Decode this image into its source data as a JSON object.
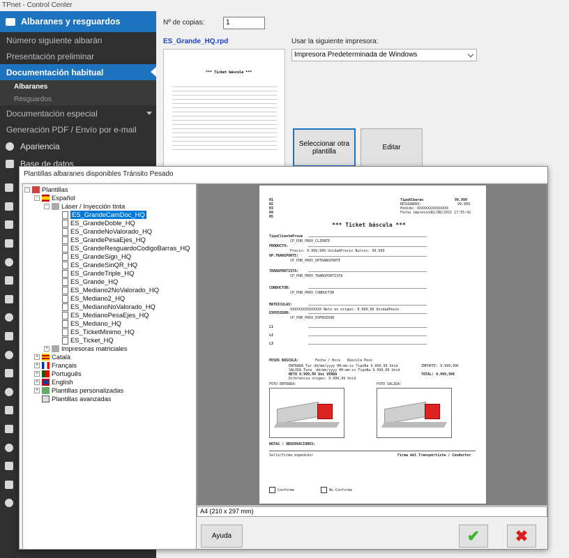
{
  "window": {
    "title": "TPnet - Control Center"
  },
  "sidebar": {
    "header": "Albaranes y resguardos",
    "items": [
      {
        "label": "Número siguiente albarán"
      },
      {
        "label": "Presentación preliminar"
      },
      {
        "label": "Documentación habitual"
      },
      {
        "label": "Documentación especial"
      },
      {
        "label": "Generación PDF / Envío por e-mail"
      }
    ],
    "subitems": [
      {
        "label": "Albaranes"
      },
      {
        "label": "Resguardos"
      }
    ],
    "icon_items": [
      {
        "label": "Apariencia"
      },
      {
        "label": "Base de datos"
      }
    ]
  },
  "main": {
    "copies_label": "Nº de copias:",
    "copies_value": "1",
    "file_name": "ES_Grande_HQ.rpd",
    "printer_label": "Usar la siguiente impresora:",
    "printer_value": "Impresora Predeterminada de Windows",
    "select_template_button": "Seleccionar otra plantilla",
    "edit_button": "Editar"
  },
  "dialog": {
    "title": "Plantillas albaranes disponibles Tránsito Pesado",
    "tree": {
      "root": "Plantillas",
      "language_es": "Español",
      "laser_folder": "Láser / Inyección tinta",
      "templates": [
        "ES_GrandeCamDoc_HQ",
        "ES_GrandeDoble_HQ",
        "ES_GrandeNoValorado_HQ",
        "ES_GrandePesaEjes_HQ",
        "ES_GrandeResguardoCodigoBarras_HQ",
        "ES_GrandeSign_HQ",
        "ES_GrandeSinQR_HQ",
        "ES_GrandeTriple_HQ",
        "ES_Grande_HQ",
        "ES_Mediano2NoValorado_HQ",
        "ES_Mediano2_HQ",
        "ES_MedianoNoValorado_HQ",
        "ES_MedianoPesaEjes_HQ",
        "ES_Mediano_HQ",
        "ES_TicketMinimo_HQ",
        "ES_Ticket_HQ"
      ],
      "matrix_folder": "Impresoras matriciales",
      "other_languages": [
        "Català",
        "Français",
        "Português",
        "English"
      ],
      "custom": "Plantillas personalizadas",
      "advanced": "Plantillas avanzadas"
    },
    "paper_size": "A4 (210 x 297 mm)",
    "help_button": "Ayuda",
    "ok_symbol": "✔",
    "cancel_symbol": "✖"
  },
  "preview": {
    "h_lines": [
      "H1",
      "H2",
      "H3",
      "H4",
      "H5"
    ],
    "doc_type_label": "TipoAlbaran",
    "doc_number": "99.999",
    "resguardo_label": "RESGUARDO:",
    "resguardo_value": "99.999",
    "pedido_label": "Pedido:",
    "pedido_value": "XXXXXXXXXXXXXXX",
    "fecha_label": "Fecha impresión:",
    "fecha_value": "11/08/2021 17:55:42",
    "title": "*** Ticket báscula ***",
    "sections": [
      {
        "label": "TipoClienteProve",
        "sub": "CP_POB_PROV_CLIENTE"
      },
      {
        "label": "PRODUCTO:",
        "sub": "Precio: 9.999,999 UnidadPrecio   Bultos: 99.999"
      },
      {
        "label": "OP.TRANSPORTE:",
        "sub": "CP_POB_PROV_OPTRANSPORTE"
      },
      {
        "label": "TRANSPORTISTA:",
        "sub": "CP_POB_PROV_TRANSPORTISTA"
      },
      {
        "label": "CONDUCTOR:",
        "sub": "CP_POB_PROV_CONDUCTOR"
      },
      {
        "label": "MATRÍCULAS:",
        "sub": "XXXXXXXXXXXXXXX   Neto en origen: 9.999,99 UnidadPesos"
      },
      {
        "label": "EXPEDIDOR:",
        "sub": "CP_POB_PROV_EXPEDIDOR"
      },
      {
        "label": "L1",
        "sub": ""
      },
      {
        "label": "L2",
        "sub": ""
      },
      {
        "label": "L3",
        "sub": ""
      }
    ],
    "pesos_label": "PESOS BÁSCULA:",
    "col_fecha": "Fecha / Hora",
    "col_bascula": "Báscula",
    "col_peso": "Peso",
    "entrada": "ENTRADA_Tar  dd/mm/yyyy HH:mm:ss  TipoBa  9.999,99 Unid",
    "salida": "SALIDA_Tara_  dd/mm/yyyy HH:mm:ss  TipoBa  9.999,99 Unid",
    "neto": "NETO                       9.999,99 Uni VERDA",
    "diferencia": "Diferencia origen:         9.999,99 Unid",
    "importe": "IMPORTE:        9.999,99€",
    "total": "TOTAL:          9.999,99€",
    "foto_entrada": "FOTO ENTRADA:",
    "foto_salida": "FOTO SALIDA:",
    "notas": "NOTAS / OBSERVACIONES:",
    "sello": "Sello/firma expedidor",
    "firma": "Firma del Transportista / Conductor",
    "conforme": "Conforme",
    "no_conforme": "No Conforme"
  },
  "colors": {
    "accent": "#1e73be",
    "sidebar_bg": "#2f2f2f",
    "ok": "#3ab52e",
    "cancel": "#d62020"
  }
}
